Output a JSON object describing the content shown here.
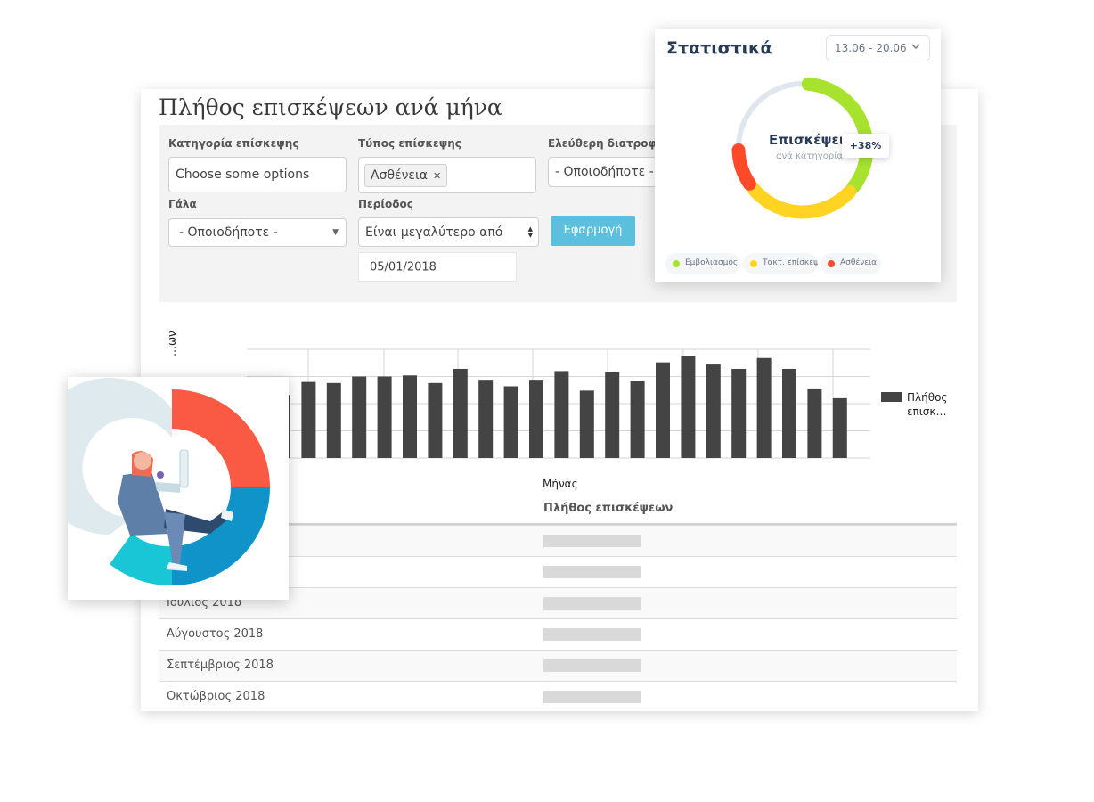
{
  "report": {
    "title": "Πλήθος επισκέψεων ανά μήνα",
    "filters": {
      "visit_category": {
        "label": "Κατηγορία επίσκεψης",
        "placeholder": "Choose some options"
      },
      "visit_type": {
        "label": "Τύπος επίσκεψης",
        "tag": "Ασθένεια",
        "remove_glyph": "✕"
      },
      "free_diet": {
        "label": "Ελεύθερη διατροφή",
        "value": "- Οποιοδήποτε -"
      },
      "milk": {
        "label": "Γάλα",
        "value": "- Οποιοδήποτε -"
      },
      "period": {
        "label": "Περίοδος",
        "operator": "Είναι μεγαλύτερο από",
        "date": "05/01/2018"
      },
      "apply_label": "Εφαρμογή"
    },
    "table": {
      "col_month": "Μήνας",
      "col_visits": "Πλήθος επισκέψεων",
      "rows": [
        {
          "month": ""
        },
        {
          "month": ""
        },
        {
          "month": "Ιούλιος 2018"
        },
        {
          "month": "Αύγουστος 2018"
        },
        {
          "month": "Σεπτέμβριος 2018"
        },
        {
          "month": "Οκτώβριος 2018"
        }
      ]
    }
  },
  "chart_data": {
    "type": "bar",
    "title": "",
    "xlabel": "",
    "ylabel": "…ων",
    "legend": "Πλήθος επισκ…",
    "series": [
      {
        "name": "Πλήθος επισκ…",
        "color": "#444444",
        "values": [
          58,
          70,
          69,
          75,
          75,
          76,
          69,
          82,
          72,
          66,
          72,
          80,
          62,
          79,
          71,
          88,
          94,
          86,
          82,
          92,
          82,
          64,
          55
        ]
      }
    ],
    "ylim": [
      0,
      100
    ],
    "grid": true,
    "legend_position": "right"
  },
  "stats_widget": {
    "title": "Στατιστικά",
    "date_range": "13.06 - 20.06",
    "center_label": "Επισκέψεις",
    "center_sublabel": "ανά κατηγορία",
    "change_badge": "+38%",
    "legend": [
      {
        "label": "Εμβολιασμός",
        "color": "#a6e22e"
      },
      {
        "label": "Τακτ. επίσκεψη",
        "color": "#ffd321"
      },
      {
        "label": "Ασθένεια",
        "color": "#ff4a2a"
      }
    ]
  }
}
